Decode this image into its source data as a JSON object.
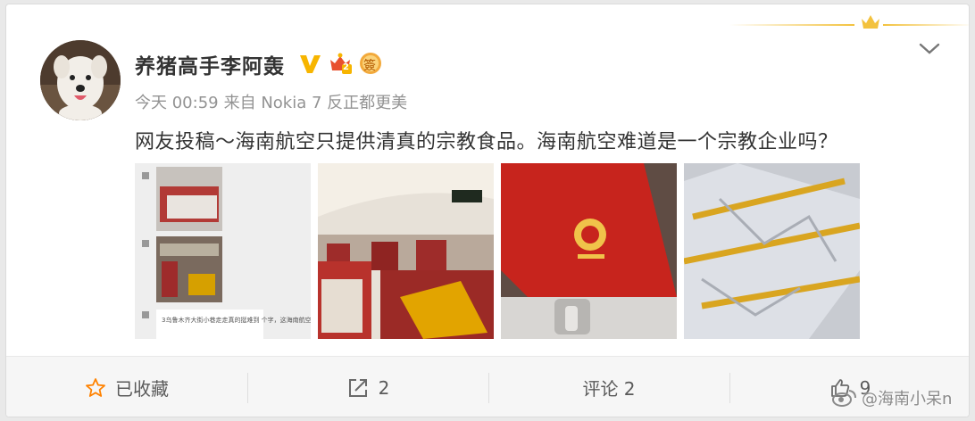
{
  "user": {
    "name": "养猪高手李阿轰",
    "verified_badge": "V",
    "level_badge": "2",
    "badge_label": "簽"
  },
  "meta": {
    "time": "今天 00:59",
    "source": "来自 Nokia 7 反正都更美"
  },
  "post": {
    "text": "网友投稿～海南航空只提供清真的宗教食品。海南航空难道是一个宗教企业吗？"
  },
  "images": [
    {
      "name": "chat-screenshot-image"
    },
    {
      "name": "cabin-seats-image"
    },
    {
      "name": "hainan-airlines-card-image"
    },
    {
      "name": "foil-wrapped-food-image"
    }
  ],
  "image_text": {
    "chat_caption": "3乌鲁木齐大街小巷走走真的挺难到 个字，这海南航空 却是这样的标语这是海南航空 能不能也准备些"
  },
  "actions": {
    "favorite": "已收藏",
    "share_count": "2",
    "comment": "评论 2",
    "like_count": "9"
  },
  "watermark": {
    "text": "@海南小呆n"
  },
  "colors": {
    "accent": "#ff8200",
    "verified": "#f7b500",
    "text": "#333333",
    "meta": "#939393",
    "actions_bg": "#f6f6f6"
  }
}
